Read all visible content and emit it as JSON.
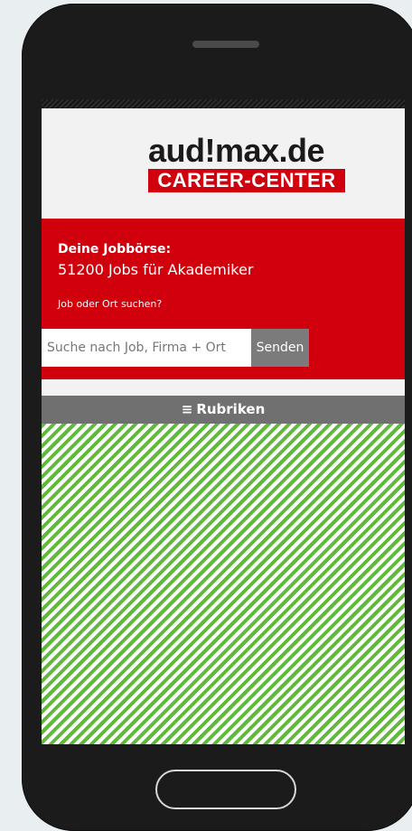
{
  "branding": {
    "logo_top": "aud!max.de",
    "logo_bottom": "CAREER-CENTER"
  },
  "hero": {
    "heading": "Deine Jobbörse:",
    "jobs_text": "51200 Jobs für Akademiker",
    "question": "Job oder Ort suchen?"
  },
  "search": {
    "placeholder": "Suche nach Job, Firma + Ort",
    "button_label": "Senden"
  },
  "categories": {
    "icon": "hamburger-menu-icon",
    "icon_glyph": "≡",
    "label": "Rubriken"
  },
  "colors": {
    "brand_red": "#d0000c",
    "button_gray": "#7b7b7b",
    "stripe_green": "#5fba3b"
  }
}
